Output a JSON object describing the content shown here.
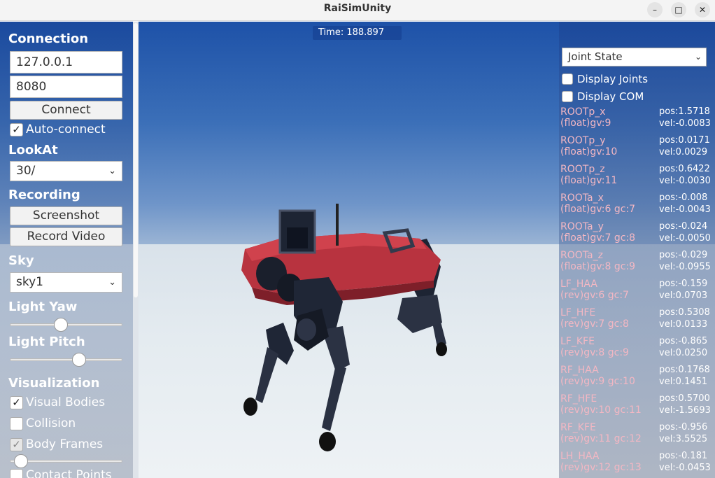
{
  "window": {
    "title": "RaiSimUnity",
    "minimize_icon": "minimize-icon",
    "maximize_icon": "maximize-icon",
    "close_icon": "close-icon"
  },
  "viewport": {
    "time_label": "Time: 188.897"
  },
  "connection": {
    "title": "Connection",
    "address": "127.0.0.1",
    "port": "8080",
    "connect_label": "Connect",
    "auto_connect_label": "Auto-connect",
    "auto_connect_checked": true
  },
  "lookat": {
    "title": "LookAt",
    "selected": "30/"
  },
  "recording": {
    "title": "Recording",
    "screenshot_label": "Screenshot",
    "record_video_label": "Record Video"
  },
  "sky": {
    "title": "Sky",
    "selected": "sky1"
  },
  "light_yaw": {
    "title": "Light Yaw",
    "value_fraction": 0.45
  },
  "light_pitch": {
    "title": "Light Pitch",
    "value_fraction": 0.63
  },
  "visualization": {
    "title": "Visualization",
    "visual_bodies_label": "Visual Bodies",
    "collision_label": "Collision",
    "body_frames_label": "Body Frames",
    "body_frames_slider_fraction": 0.04,
    "contact_points_label": "Contact Points"
  },
  "right_panel": {
    "dropdown": "Joint State",
    "display_joints_label": "Display Joints",
    "display_com_label": "Display COM",
    "joints": [
      {
        "name": "ROOTp_x",
        "type": "(float)gv:9",
        "pos": "pos:1.5718",
        "vel": "vel:-0.0083"
      },
      {
        "name": "ROOTp_y",
        "type": "(float)gv:10",
        "pos": "pos:0.0171",
        "vel": "vel:0.0029"
      },
      {
        "name": "ROOTp_z",
        "type": "(float)gv:11",
        "pos": "pos:0.6422",
        "vel": "vel:-0.0030"
      },
      {
        "name": "ROOTa_x",
        "type": "(float)gv:6 gc:7",
        "pos": "pos:-0.008",
        "vel": "vel:-0.0043"
      },
      {
        "name": "ROOTa_y",
        "type": "(float)gv:7 gc:8",
        "pos": "pos:-0.024",
        "vel": "vel:-0.0050"
      },
      {
        "name": "ROOTa_z",
        "type": "(float)gv:8 gc:9",
        "pos": "pos:-0.029",
        "vel": "vel:-0.0955"
      },
      {
        "name": "LF_HAA",
        "type": "(rev)gv:6 gc:7",
        "pos": "pos:-0.159",
        "vel": "vel:0.0703"
      },
      {
        "name": "LF_HFE",
        "type": "(rev)gv:7 gc:8",
        "pos": "pos:0.5308",
        "vel": "vel:0.0133"
      },
      {
        "name": "LF_KFE",
        "type": "(rev)gv:8 gc:9",
        "pos": "pos:-0.865",
        "vel": "vel:0.0250"
      },
      {
        "name": "RF_HAA",
        "type": "(rev)gv:9 gc:10",
        "pos": "pos:0.1768",
        "vel": "vel:0.1451"
      },
      {
        "name": "RF_HFE",
        "type": "(rev)gv:10 gc:11",
        "pos": "pos:0.5700",
        "vel": "vel:-1.5693"
      },
      {
        "name": "RF_KFE",
        "type": "(rev)gv:11 gc:12",
        "pos": "pos:-0.956",
        "vel": "vel:3.5525"
      },
      {
        "name": "LH_HAA",
        "type": "(rev)gv:12 gc:13",
        "pos": "pos:-0.181",
        "vel": "vel:-0.0453"
      }
    ]
  }
}
